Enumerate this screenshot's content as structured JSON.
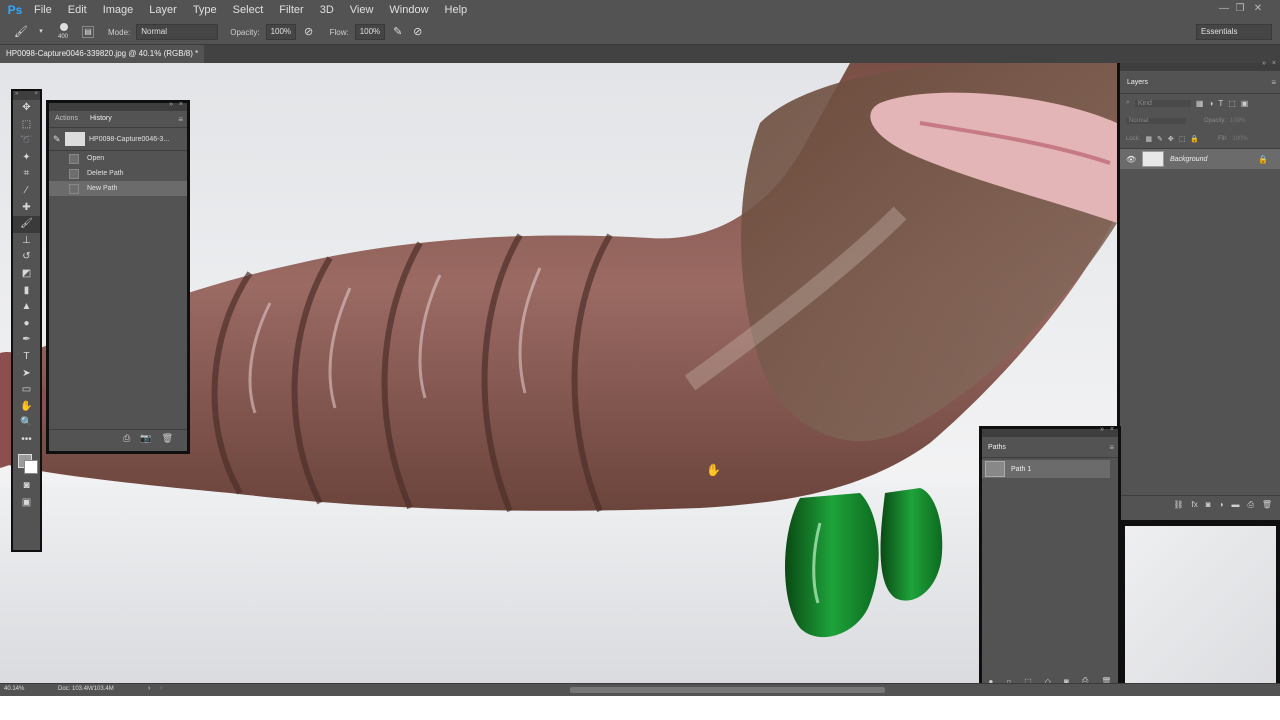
{
  "app": {
    "logo": "Ps",
    "menu": [
      "File",
      "Edit",
      "Image",
      "Layer",
      "Type",
      "Select",
      "Filter",
      "3D",
      "View",
      "Window",
      "Help"
    ],
    "window_controls": [
      "minimize-icon",
      "restore-icon",
      "close-icon"
    ]
  },
  "options": {
    "brush_size": "400",
    "mode_label": "Mode:",
    "mode_value": "Normal",
    "opacity_label": "Opacity:",
    "opacity_value": "100%",
    "flow_label": "Flow:",
    "flow_value": "100%",
    "workspace": "Essentials"
  },
  "document": {
    "tab_title": "HP0098-Capture0046-339820.jpg @ 40.1% (RGB/8) *"
  },
  "history_panel": {
    "tabs": [
      "Actions",
      "History"
    ],
    "active_tab": "History",
    "snapshot": "HP0098-Capture0046-3...",
    "items": [
      "Open",
      "Delete Path",
      "New Path"
    ],
    "selected_item": "New Path"
  },
  "layers_panel": {
    "title": "Layers",
    "kind_placeholder": "Kind",
    "blend_mode": "Normal",
    "opacity_label": "Opacity:",
    "opacity_value": "100%",
    "lock_label": "Lock:",
    "fill_label": "Fill:",
    "fill_value": "100%",
    "layers": [
      {
        "name": "Background",
        "visible": true,
        "locked": true
      }
    ]
  },
  "paths_panel": {
    "title": "Paths",
    "items": [
      "Path 1"
    ]
  },
  "status": {
    "zoom": "40.14%",
    "doc_info": "Doc: 103.4M/103.4M"
  },
  "colors": {
    "ui_bg": "#535353",
    "panel_dark": "#3e3e3e",
    "border": "#0f0f0f",
    "selection": "#6b6b6b",
    "accent": "#31a8ff"
  }
}
